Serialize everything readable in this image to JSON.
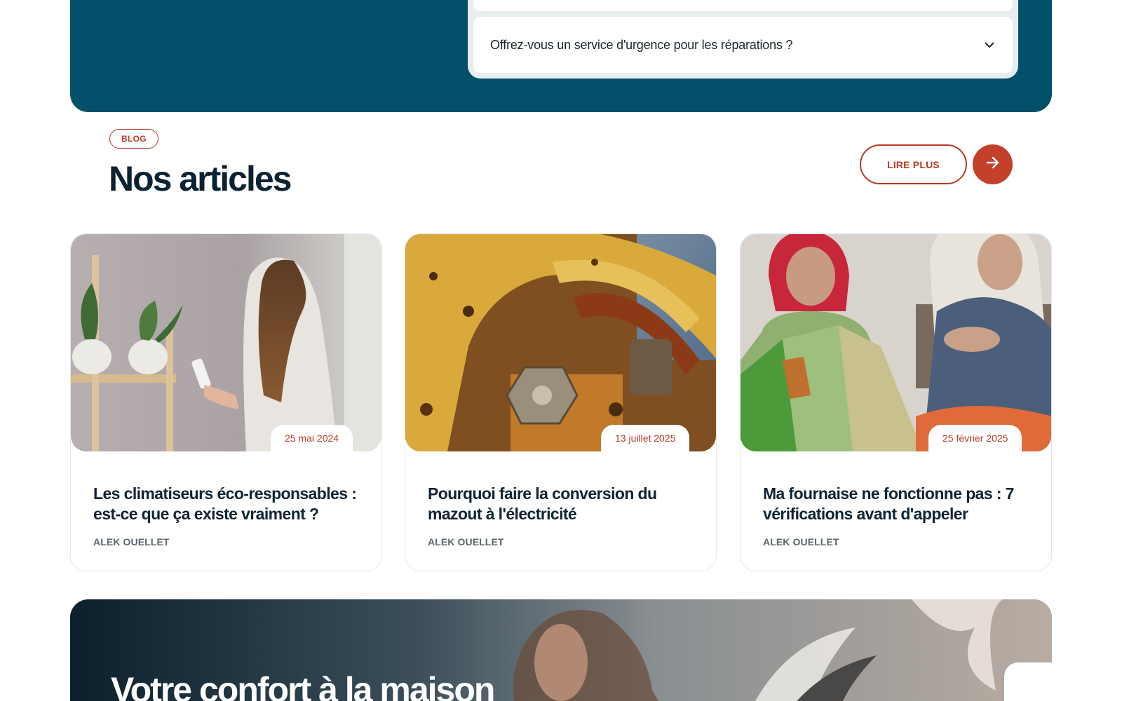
{
  "faq": {
    "question": "Offrez-vous un service d'urgence pour les réparations ?"
  },
  "blog": {
    "badge": "BLOG",
    "title": "Nos articles",
    "read_more": "LIRE PLUS",
    "articles": [
      {
        "date": "25 mai 2024",
        "title": "Les climatiseurs éco-responsables : est-ce que ça existe vraiment ?",
        "author": "ALEK OUELLET"
      },
      {
        "date": "13 juillet 2025",
        "title": "Pourquoi faire la conversion du mazout à l'électricité",
        "author": "ALEK OUELLET"
      },
      {
        "date": "25 février 2025",
        "title": "Ma fournaise ne fonctionne pas : 7 vérifications avant d'appeler",
        "author": "ALEK OUELLET"
      }
    ]
  },
  "banner": {
    "title": "Votre confort à la maison"
  },
  "colors": {
    "teal": "#03506b",
    "accent": "#b93a22",
    "navy": "#0b2233"
  }
}
